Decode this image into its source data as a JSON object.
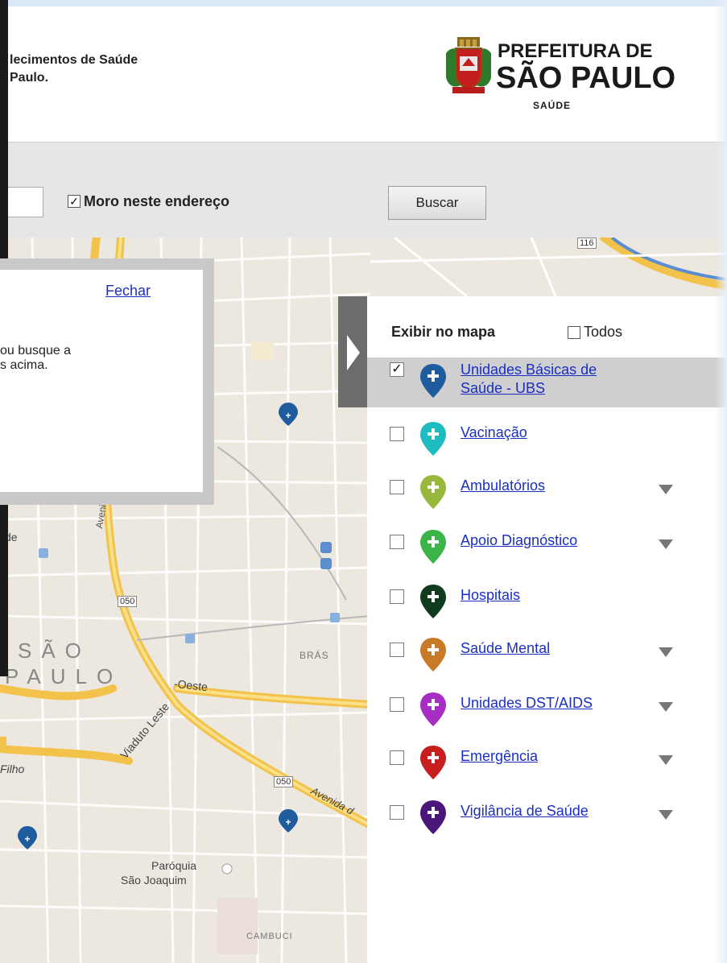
{
  "header": {
    "subtitle": "lecimentos de Saúde\n Paulo.",
    "logo": {
      "line1": "PREFEITURA DE",
      "line2": "SÃO PAULO",
      "line3": "SAÚDE"
    }
  },
  "search": {
    "address_value": "",
    "moro_checked": true,
    "moro_label": "Moro neste endereço",
    "buscar_label": "Buscar"
  },
  "popup": {
    "close_label": "Fechar",
    "text": "ou busque a\ns acima."
  },
  "map": {
    "labels": {
      "sao": "SÃO",
      "paulo": "PAULO",
      "bras": "BRÁS",
      "paroquia": "Paróquia",
      "sao_joaquim": "São Joaquim",
      "cambuci": "CAMBUCI",
      "avenida": "Avenida do",
      "viaduto": "Viaduto Leste",
      "oeste": "-Oeste",
      "avenida2": "Avenida d",
      "filho": "Filho",
      "de": "de",
      "route_050a": "050",
      "route_050b": "050",
      "route_116": "116"
    }
  },
  "panel": {
    "title": "Exibir no mapa",
    "todos_label": "Todos",
    "todos_checked": false,
    "categories": [
      {
        "label": "Unidades Básicas de\nSaúde - UBS",
        "color": "#1e5c9e",
        "checked": true,
        "selected": true,
        "has_arrow": false,
        "icon": "ubs-pin-icon"
      },
      {
        "label": "Vacinação",
        "color": "#1ebcc0",
        "checked": false,
        "selected": false,
        "has_arrow": false,
        "icon": "vacinacao-pin-icon"
      },
      {
        "label": "Ambulatórios",
        "color": "#97b83a",
        "checked": false,
        "selected": false,
        "has_arrow": true,
        "icon": "ambulatorios-pin-icon"
      },
      {
        "label": "Apoio Diagnóstico",
        "color": "#3bb54a",
        "checked": false,
        "selected": false,
        "has_arrow": true,
        "icon": "apoio-diagnostico-pin-icon"
      },
      {
        "label": "Hospitais",
        "color": "#0f3b1e",
        "checked": false,
        "selected": false,
        "has_arrow": false,
        "icon": "hospitais-pin-icon"
      },
      {
        "label": "Saúde Mental",
        "color": "#c97a28",
        "checked": false,
        "selected": false,
        "has_arrow": true,
        "icon": "saude-mental-pin-icon"
      },
      {
        "label": "Unidades DST/AIDS",
        "color": "#a62ec2",
        "checked": false,
        "selected": false,
        "has_arrow": true,
        "icon": "dst-aids-pin-icon"
      },
      {
        "label": "Emergência",
        "color": "#c71e1e",
        "checked": false,
        "selected": false,
        "has_arrow": true,
        "icon": "emergencia-pin-icon"
      },
      {
        "label": "Vigilância de Saúde",
        "color": "#4a167a",
        "checked": false,
        "selected": false,
        "has_arrow": true,
        "icon": "vigilancia-pin-icon"
      }
    ]
  }
}
